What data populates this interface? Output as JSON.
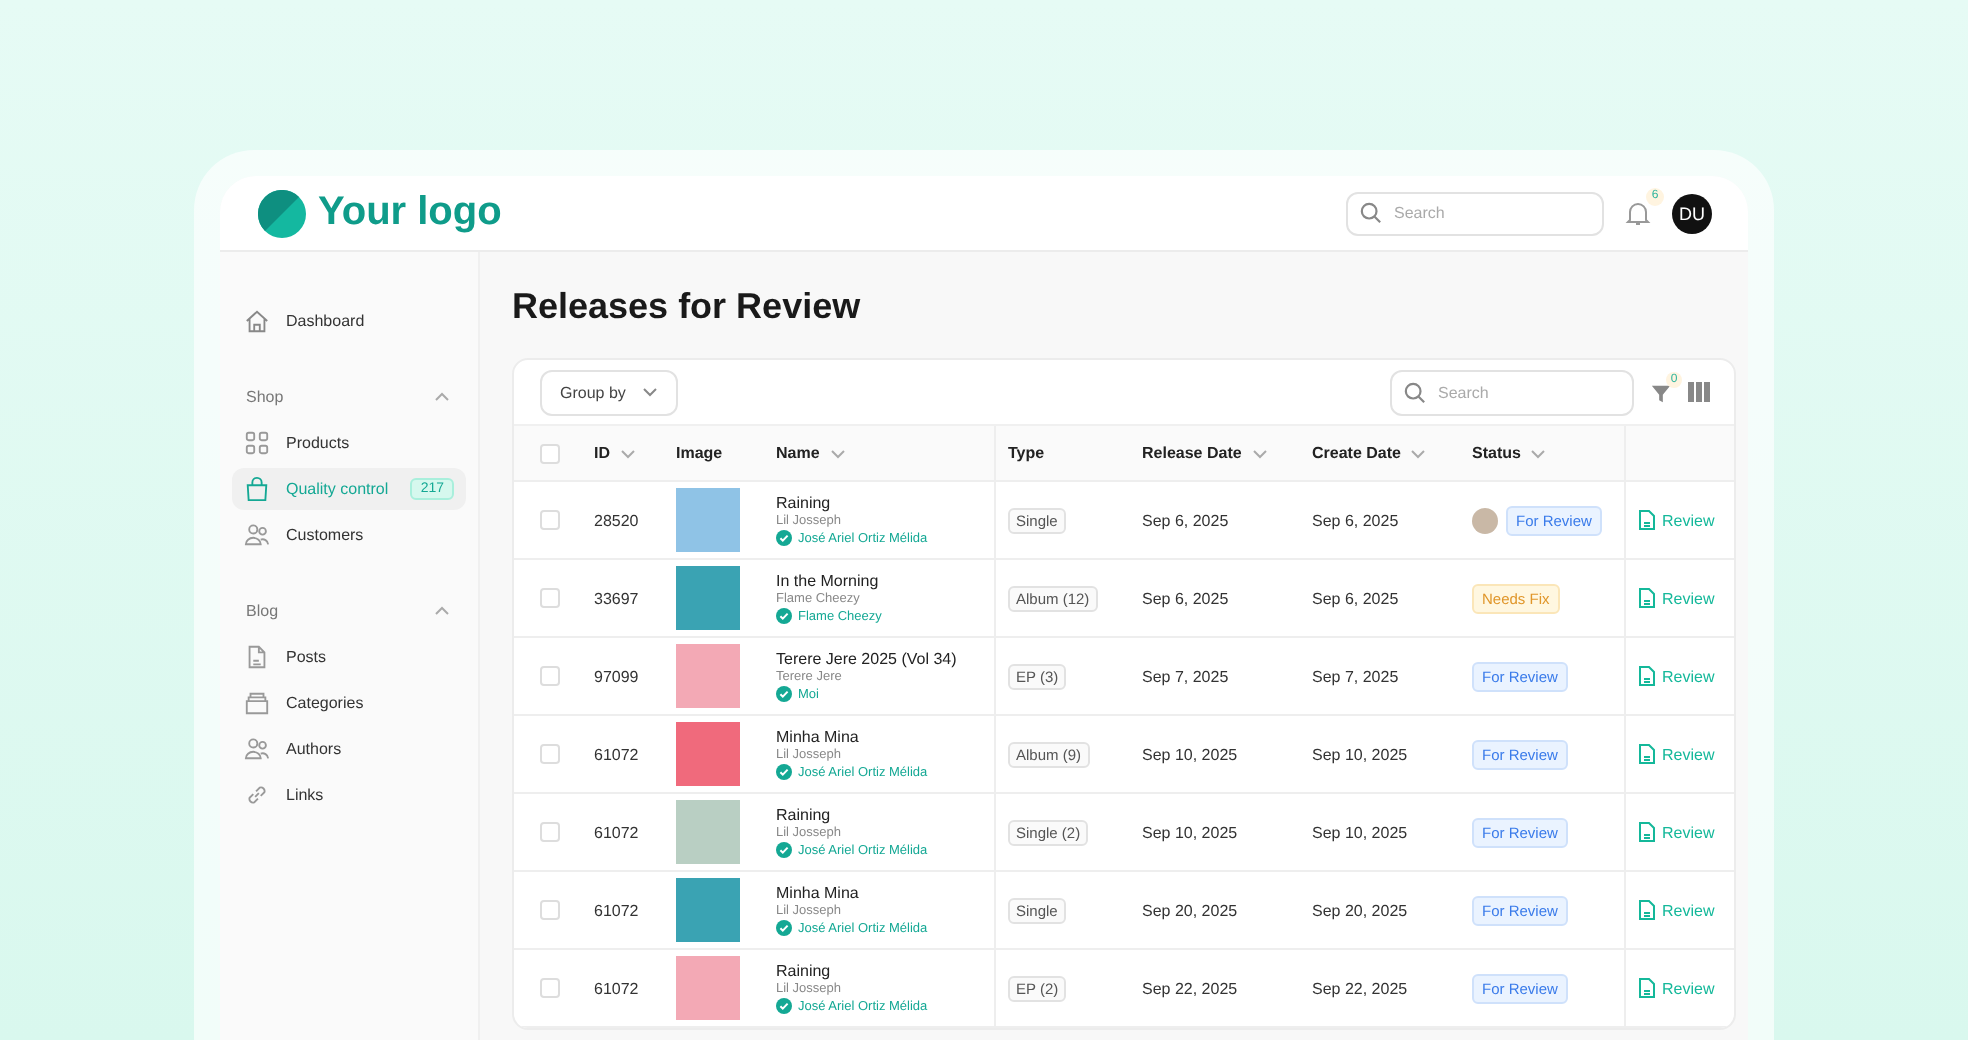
{
  "logo": {
    "text": "Your logo"
  },
  "header": {
    "search": {
      "placeholder": "Search"
    },
    "notifications": "6",
    "avatar": "DU"
  },
  "sidebar": {
    "items": [
      {
        "kind": "link",
        "label": "Dashboard",
        "selected": false
      }
    ],
    "sections": [
      {
        "title": "Shop",
        "expanded": true,
        "items": [
          {
            "label": "Products",
            "selected": false
          },
          {
            "label": "Quality control",
            "selected": true,
            "badge": "217"
          },
          {
            "label": "Customers",
            "selected": false
          }
        ]
      },
      {
        "title": "Blog",
        "expanded": true,
        "items": [
          {
            "label": "Posts",
            "selected": false
          },
          {
            "label": "Categories",
            "selected": false
          },
          {
            "label": "Authors",
            "selected": false
          },
          {
            "label": "Links",
            "selected": false
          }
        ]
      }
    ]
  },
  "page": {
    "title": "Releases for Review"
  },
  "toolbar": {
    "group_by": "Group by",
    "search": {
      "placeholder": "Search"
    },
    "filter_count": "0"
  },
  "table": {
    "select_all_checked": false,
    "columns": [
      {
        "label": "ID",
        "sortable": true
      },
      {
        "label": "Image",
        "sortable": false
      },
      {
        "label": "Name",
        "sortable": true
      },
      {
        "label": "Type",
        "sortable": false
      },
      {
        "label": "Release Date",
        "sortable": true
      },
      {
        "label": "Create Date",
        "sortable": true
      },
      {
        "label": "Status",
        "sortable": true
      }
    ],
    "rows": [
      {
        "checked": false,
        "id": "28520",
        "name": "Raining",
        "artist": "Lil Josseph",
        "reviewer": "José Ariel Ortiz Mélida",
        "type": "Single",
        "release_date": "Sep 6, 2025",
        "create_date": "Sep 6, 2025",
        "status": "For Review",
        "kind": "review",
        "reviewer_avatar": true,
        "action": "Review"
      },
      {
        "checked": false,
        "id": "33697",
        "name": "In the Morning",
        "artist": "Flame Cheezy",
        "reviewer": "Flame Cheezy",
        "type": "Album (12)",
        "release_date": "Sep 6, 2025",
        "create_date": "Sep 6, 2025",
        "status": "Needs Fix",
        "kind": "fix",
        "reviewer_avatar": false,
        "action": "Review"
      },
      {
        "checked": false,
        "id": "97099",
        "name": "Terere Jere 2025 (Vol 34)",
        "artist": "Terere Jere",
        "reviewer": "Moi",
        "type": "EP (3)",
        "release_date": "Sep 7, 2025",
        "create_date": "Sep 7, 2025",
        "status": "For Review",
        "kind": "review",
        "reviewer_avatar": false,
        "action": "Review"
      },
      {
        "checked": false,
        "id": "61072",
        "name": "Minha Mina",
        "artist": "Lil Josseph",
        "reviewer": "José Ariel Ortiz Mélida",
        "type": "Album (9)",
        "release_date": "Sep 10, 2025",
        "create_date": "Sep 10, 2025",
        "status": "For Review",
        "kind": "review",
        "reviewer_avatar": false,
        "action": "Review"
      },
      {
        "checked": false,
        "id": "61072",
        "name": "Raining",
        "artist": "Lil Josseph",
        "reviewer": "José Ariel Ortiz Mélida",
        "type": "Single (2)",
        "release_date": "Sep 10, 2025",
        "create_date": "Sep 10, 2025",
        "status": "For Review",
        "kind": "review",
        "reviewer_avatar": false,
        "action": "Review"
      },
      {
        "checked": false,
        "id": "61072",
        "name": "Minha Mina",
        "artist": "Lil Josseph",
        "reviewer": "José Ariel Ortiz Mélida",
        "type": "Single",
        "release_date": "Sep 20, 2025",
        "create_date": "Sep 20, 2025",
        "status": "For Review",
        "kind": "review",
        "reviewer_avatar": false,
        "action": "Review"
      },
      {
        "checked": false,
        "id": "61072",
        "name": "Raining",
        "artist": "Lil Josseph",
        "reviewer": "José Ariel Ortiz Mélida",
        "type": "EP (2)",
        "release_date": "Sep 22, 2025",
        "create_date": "Sep 22, 2025",
        "status": "For Review",
        "kind": "review",
        "reviewer_avatar": false,
        "action": "Review"
      }
    ]
  }
}
